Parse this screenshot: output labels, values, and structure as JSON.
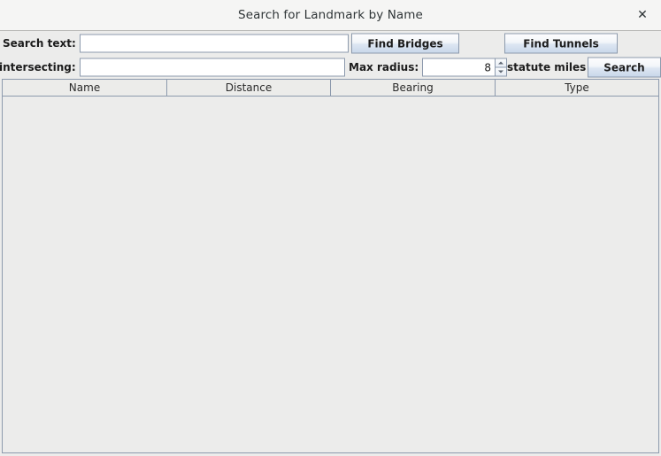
{
  "window": {
    "title": "Search for Landmark by Name",
    "close_label": "✕"
  },
  "form": {
    "search_text_label": "Search text:",
    "search_text_value": "",
    "search_text_placeholder": "",
    "intersecting_label": "intersecting:",
    "intersecting_value": "",
    "intersecting_placeholder": "",
    "find_bridges_label": "Find Bridges",
    "find_tunnels_label": "Find Tunnels",
    "max_radius_label": "Max radius:",
    "max_radius_value": "8",
    "units_label": "statute miles",
    "search_button_label": "Search"
  },
  "table": {
    "columns": [
      {
        "label": "Name"
      },
      {
        "label": "Distance"
      },
      {
        "label": "Bearing"
      },
      {
        "label": "Type"
      }
    ],
    "rows": []
  },
  "colors": {
    "window_bg": "#ececeb",
    "titlebar_bg": "#f5f5f4",
    "border": "#8d9aad",
    "button_accent": "#c9d8ea",
    "text": "#1c1c1c"
  }
}
